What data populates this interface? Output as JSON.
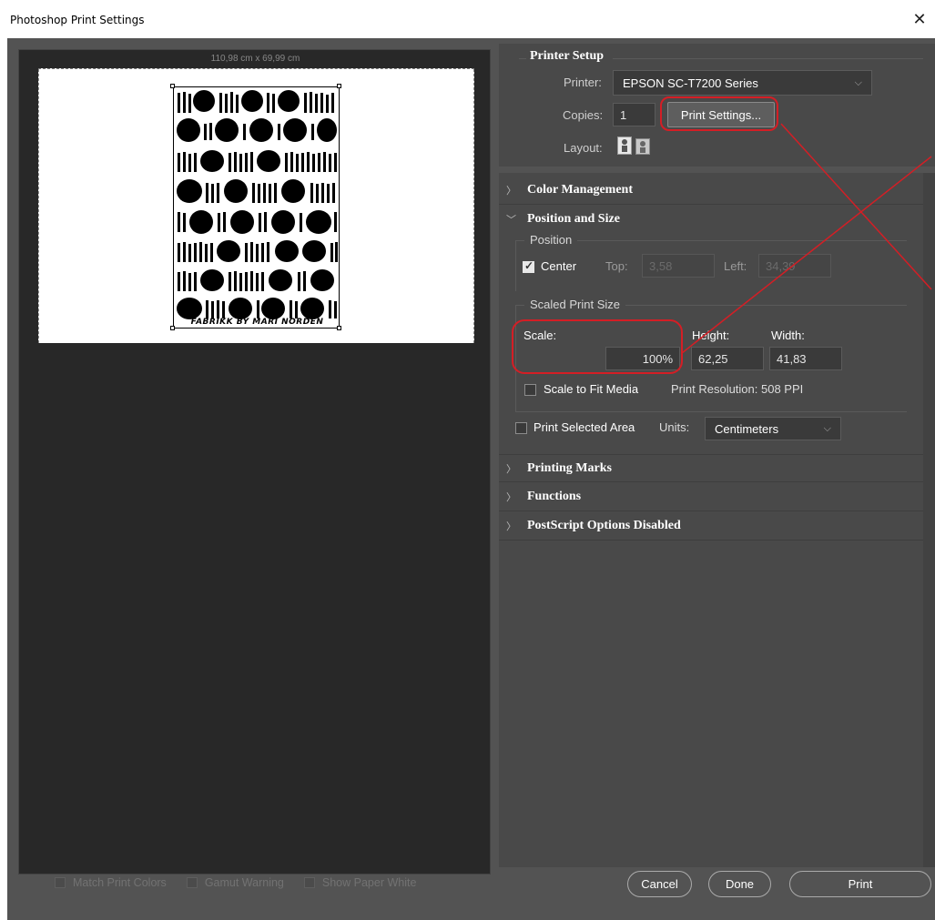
{
  "window": {
    "title": "Photoshop Print Settings",
    "close_label": "✕"
  },
  "preview": {
    "dimensions": "110,98 cm x 69,99 cm",
    "artwork_text": "FABRIKK BY MARI NORDÉN",
    "checkboxes": [
      {
        "label": "Match Print Colors",
        "checked": false,
        "enabled": false
      },
      {
        "label": "Gamut Warning",
        "checked": false,
        "enabled": false
      },
      {
        "label": "Show Paper White",
        "checked": false,
        "enabled": false
      }
    ]
  },
  "printer_setup": {
    "header": "Printer Setup",
    "printer_label": "Printer:",
    "printer_value": "EPSON SC-T7200 Series",
    "copies_label": "Copies:",
    "copies_value": "1",
    "print_settings_button": "Print Settings...",
    "layout_label": "Layout:"
  },
  "sections": {
    "color_management": "Color Management",
    "position_and_size": "Position and Size",
    "printing_marks": "Printing Marks",
    "functions": "Functions",
    "postscript": "PostScript Options Disabled"
  },
  "position": {
    "title": "Position",
    "center_label": "Center",
    "center_checked": true,
    "top_label": "Top:",
    "top_value": "3,58",
    "left_label": "Left:",
    "left_value": "34,39"
  },
  "scaled_print_size": {
    "title": "Scaled Print Size",
    "scale_label": "Scale:",
    "scale_value": "100%",
    "height_label": "Height:",
    "height_value": "62,25",
    "width_label": "Width:",
    "width_value": "41,83",
    "scale_to_fit_label": "Scale to Fit Media",
    "scale_to_fit_checked": false,
    "resolution_text": "Print Resolution: 508 PPI"
  },
  "selected_area": {
    "label": "Print Selected Area",
    "checked": false,
    "units_label": "Units:",
    "units_value": "Centimeters"
  },
  "footer": {
    "cancel": "Cancel",
    "done": "Done",
    "print": "Print"
  },
  "colors": {
    "annotation": "#d41e25",
    "dialog_bg": "#535353",
    "panel_bg": "#494949"
  }
}
